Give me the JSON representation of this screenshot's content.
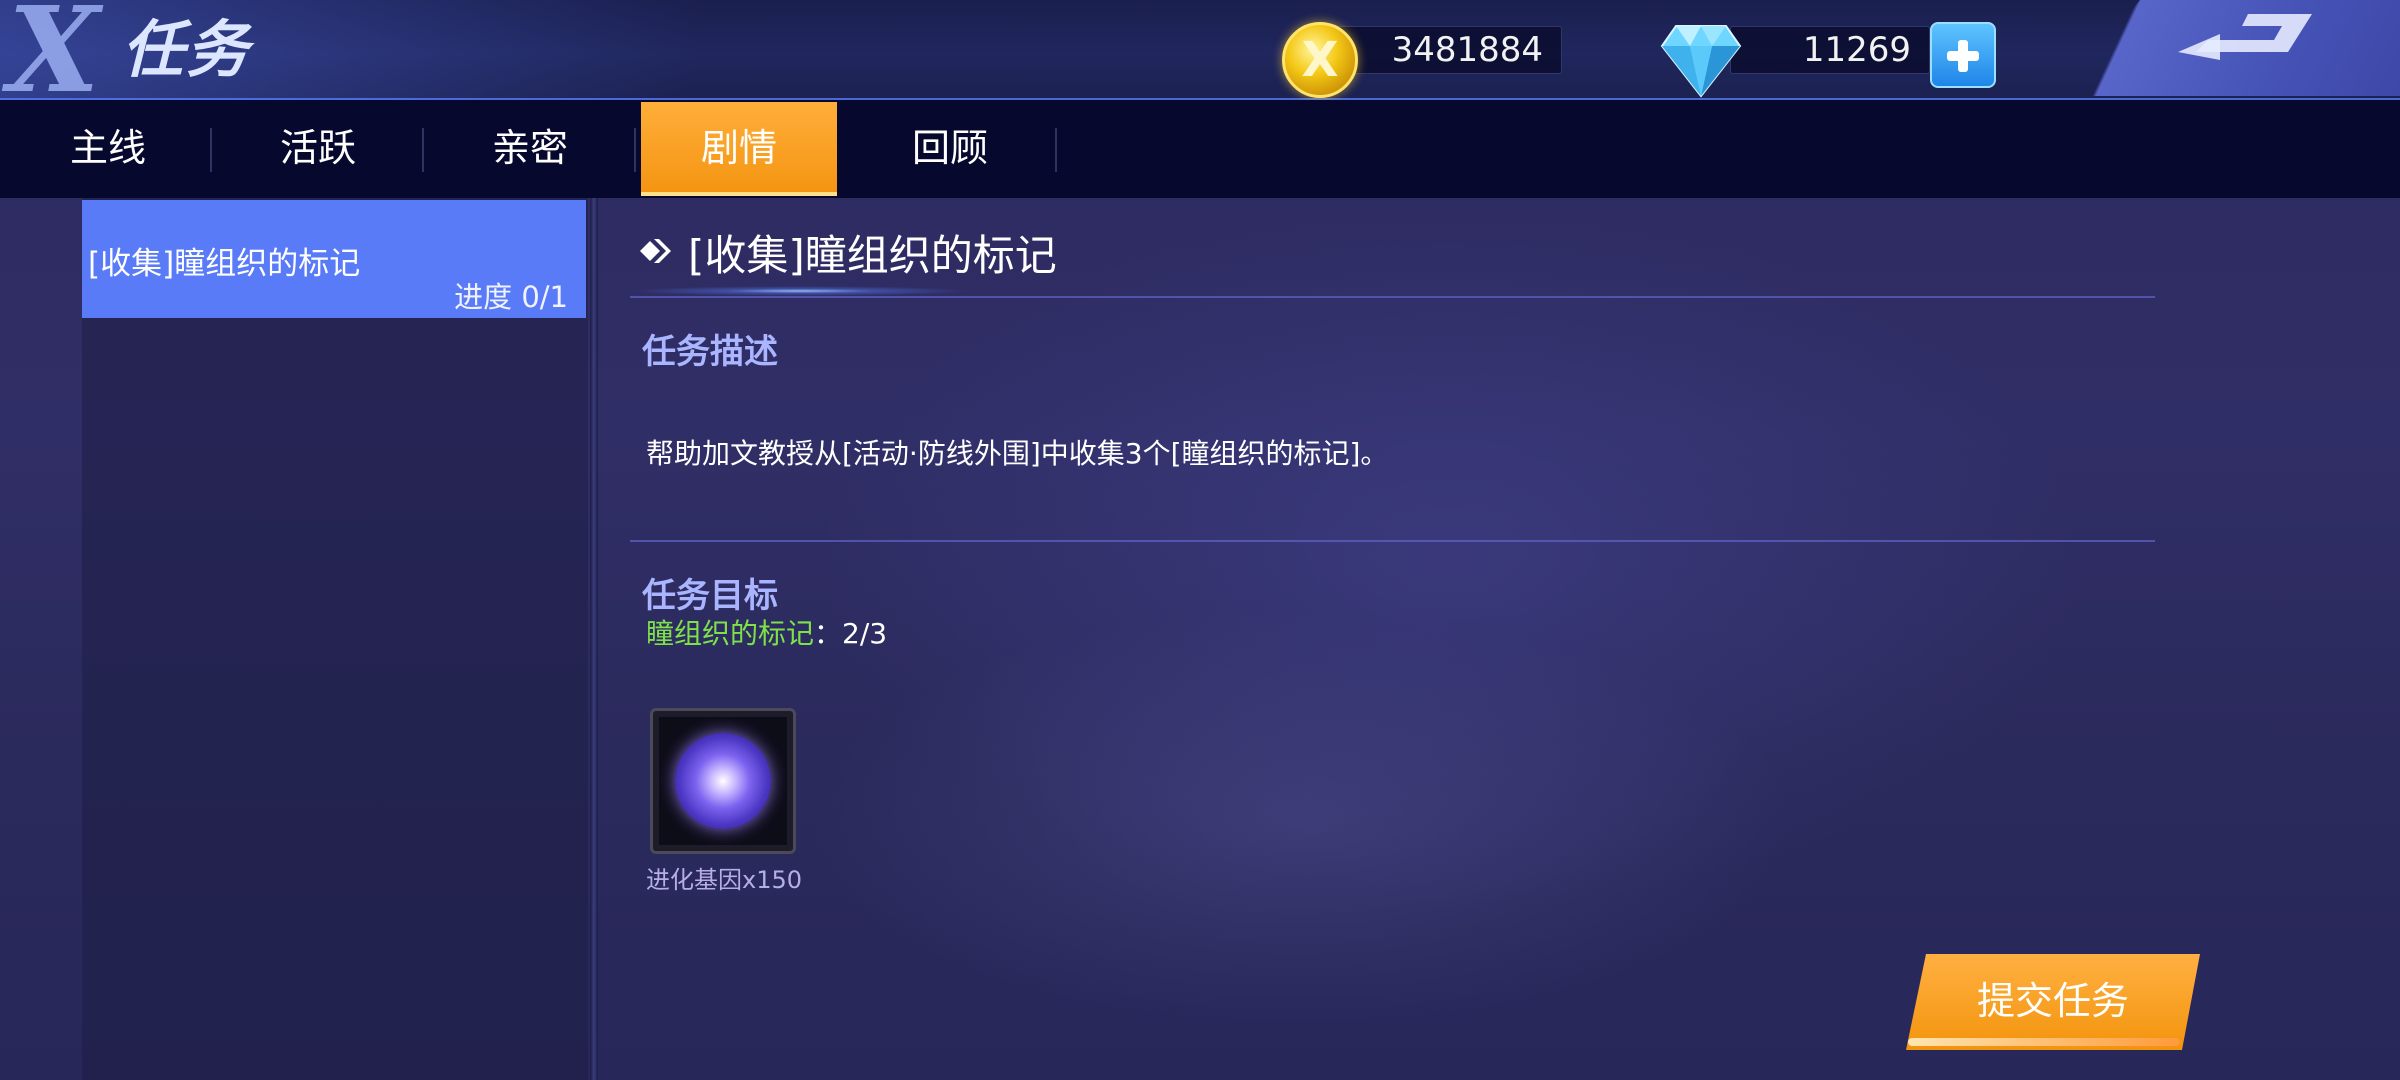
{
  "header": {
    "logo": "X",
    "title": "任务",
    "gold_amount": "3481884",
    "diamond_amount": "11269",
    "icons": {
      "gold": "gold-coin-icon",
      "diamond": "diamond-icon",
      "add": "plus-icon",
      "back": "back-arrow-icon"
    }
  },
  "tabs": [
    {
      "label": "主线",
      "active": false
    },
    {
      "label": "活跃",
      "active": false
    },
    {
      "label": "亲密",
      "active": false
    },
    {
      "label": "剧情",
      "active": true
    },
    {
      "label": "回顾",
      "active": false
    }
  ],
  "quest_list": [
    {
      "title": "[收集]瞳组织的标记",
      "progress": "进度 0/1",
      "selected": true
    }
  ],
  "detail": {
    "title": "[收集]瞳组织的标记",
    "description_heading": "任务描述",
    "description": "帮助加文教授从[活动·防线外围]中收集3个[瞳组织的标记]。",
    "objective_heading": "任务目标",
    "objective_name": "瞳组织的标记",
    "objective_separator": "：",
    "objective_count": "2/3",
    "reward_label": "进化基因x150",
    "submit_label": "提交任务"
  },
  "colors": {
    "accent_orange": "#f49512",
    "selected_item": "#5a7bf7",
    "objective_green": "#7ee14a",
    "heading_lavender": "#aab5ff"
  }
}
